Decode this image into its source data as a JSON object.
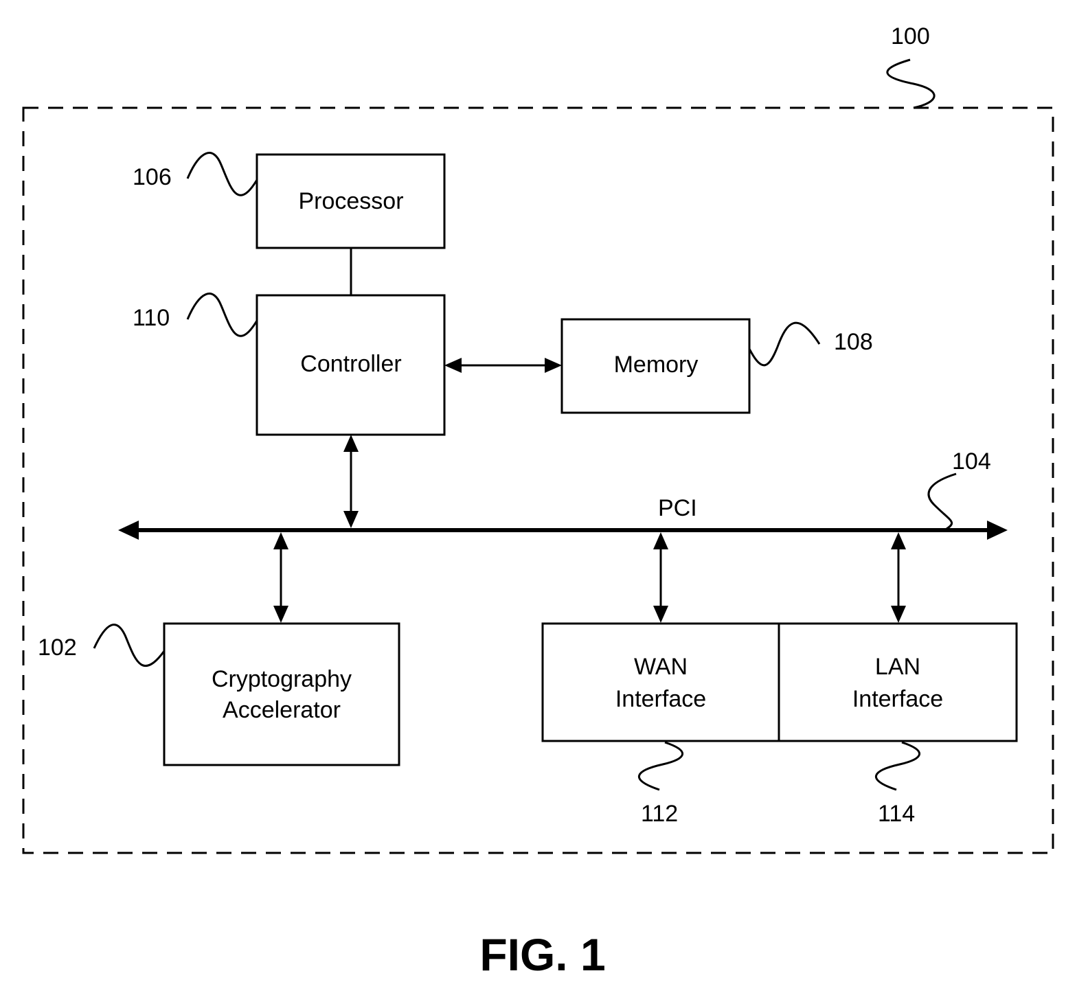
{
  "figure": {
    "caption": "FIG. 1",
    "system_ref": "100"
  },
  "blocks": {
    "processor": {
      "label": "Processor",
      "ref": "106"
    },
    "controller": {
      "label": "Controller",
      "ref": "110"
    },
    "memory": {
      "label": "Memory",
      "ref": "108"
    },
    "crypto": {
      "line1": "Cryptography",
      "line2": "Accelerator",
      "ref": "102"
    },
    "wan": {
      "line1": "WAN",
      "line2": "Interface",
      "ref": "112"
    },
    "lan": {
      "line1": "LAN",
      "line2": "Interface",
      "ref": "114"
    }
  },
  "bus": {
    "label": "PCI",
    "ref": "104"
  },
  "connections": [
    {
      "from": "processor",
      "to": "controller",
      "type": "line"
    },
    {
      "from": "controller",
      "to": "memory",
      "type": "bidirectional"
    },
    {
      "from": "controller",
      "to": "bus",
      "type": "bidirectional"
    },
    {
      "from": "bus",
      "to": "crypto",
      "type": "bidirectional"
    },
    {
      "from": "bus",
      "to": "wan",
      "type": "bidirectional"
    },
    {
      "from": "bus",
      "to": "lan",
      "type": "bidirectional"
    }
  ]
}
